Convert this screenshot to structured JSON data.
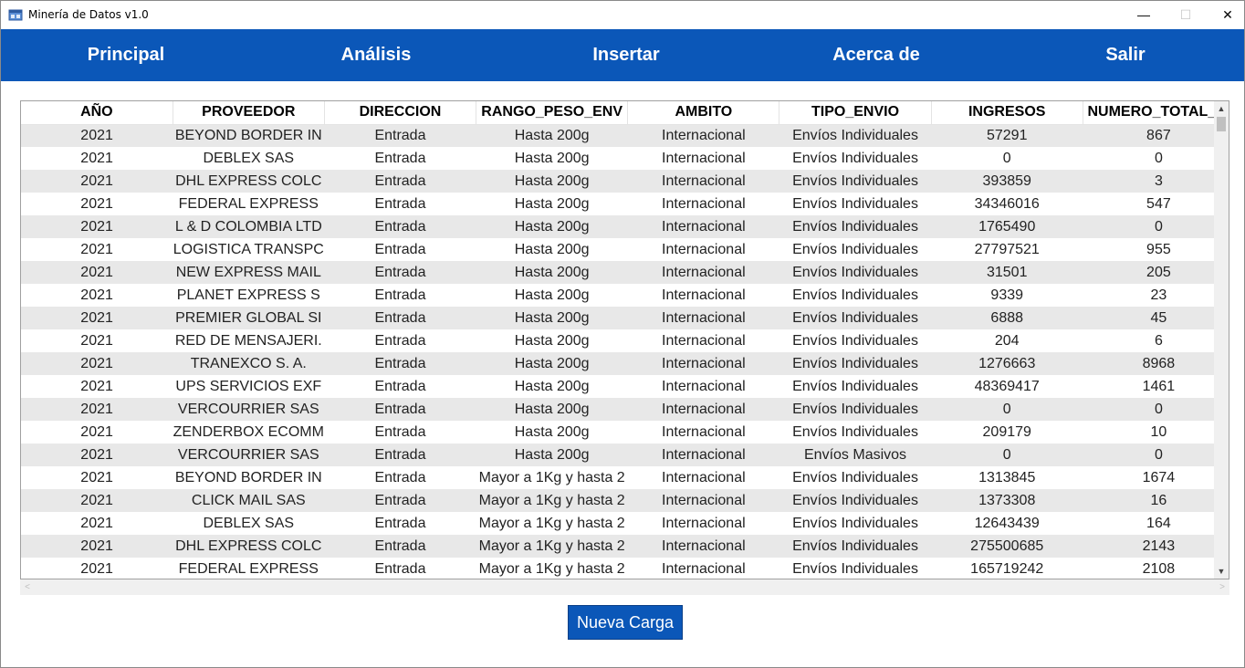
{
  "window": {
    "title": "Minería de Datos v1.0",
    "controls": {
      "minimize": "—",
      "maximize": "☐",
      "close": "✕"
    }
  },
  "nav": {
    "items": [
      {
        "label": "Principal"
      },
      {
        "label": "Análisis"
      },
      {
        "label": "Insertar"
      },
      {
        "label": "Acerca de"
      },
      {
        "label": "Salir"
      }
    ]
  },
  "table": {
    "columns": [
      "AÑO",
      "PROVEEDOR",
      "DIRECCION",
      "RANGO_PESO_ENV",
      "AMBITO",
      "TIPO_ENVIO",
      "INGRESOS",
      "NUMERO_TOTAL_EI"
    ],
    "rows": [
      [
        "2021",
        "BEYOND BORDER IN",
        "Entrada",
        "Hasta 200g",
        "Internacional",
        "Envíos Individuales",
        "57291",
        "867"
      ],
      [
        "2021",
        "DEBLEX SAS",
        "Entrada",
        "Hasta 200g",
        "Internacional",
        "Envíos Individuales",
        "0",
        "0"
      ],
      [
        "2021",
        "DHL EXPRESS COLC",
        "Entrada",
        "Hasta 200g",
        "Internacional",
        "Envíos Individuales",
        "393859",
        "3"
      ],
      [
        "2021",
        "FEDERAL EXPRESS",
        "Entrada",
        "Hasta 200g",
        "Internacional",
        "Envíos Individuales",
        "34346016",
        "547"
      ],
      [
        "2021",
        "L & D COLOMBIA LTD",
        "Entrada",
        "Hasta 200g",
        "Internacional",
        "Envíos Individuales",
        "1765490",
        "0"
      ],
      [
        "2021",
        "LOGISTICA TRANSPC",
        "Entrada",
        "Hasta 200g",
        "Internacional",
        "Envíos Individuales",
        "27797521",
        "955"
      ],
      [
        "2021",
        "NEW EXPRESS MAIL",
        "Entrada",
        "Hasta 200g",
        "Internacional",
        "Envíos Individuales",
        "31501",
        "205"
      ],
      [
        "2021",
        "PLANET EXPRESS S",
        "Entrada",
        "Hasta 200g",
        "Internacional",
        "Envíos Individuales",
        "9339",
        "23"
      ],
      [
        "2021",
        "PREMIER GLOBAL SI",
        "Entrada",
        "Hasta 200g",
        "Internacional",
        "Envíos Individuales",
        "6888",
        "45"
      ],
      [
        "2021",
        "RED DE MENSAJERI.",
        "Entrada",
        "Hasta 200g",
        "Internacional",
        "Envíos Individuales",
        "204",
        "6"
      ],
      [
        "2021",
        "TRANEXCO S. A.",
        "Entrada",
        "Hasta 200g",
        "Internacional",
        "Envíos Individuales",
        "1276663",
        "8968"
      ],
      [
        "2021",
        "UPS SERVICIOS EXF",
        "Entrada",
        "Hasta 200g",
        "Internacional",
        "Envíos Individuales",
        "48369417",
        "1461"
      ],
      [
        "2021",
        "VERCOURRIER SAS",
        "Entrada",
        "Hasta 200g",
        "Internacional",
        "Envíos Individuales",
        "0",
        "0"
      ],
      [
        "2021",
        "ZENDERBOX ECOMM",
        "Entrada",
        "Hasta 200g",
        "Internacional",
        "Envíos Individuales",
        "209179",
        "10"
      ],
      [
        "2021",
        "VERCOURRIER SAS",
        "Entrada",
        "Hasta 200g",
        "Internacional",
        "Envíos Masivos",
        "0",
        "0"
      ],
      [
        "2021",
        "BEYOND BORDER IN",
        "Entrada",
        "Mayor a 1Kg y hasta 2",
        "Internacional",
        "Envíos Individuales",
        "1313845",
        "1674"
      ],
      [
        "2021",
        "CLICK MAIL SAS",
        "Entrada",
        "Mayor a 1Kg y hasta 2",
        "Internacional",
        "Envíos Individuales",
        "1373308",
        "16"
      ],
      [
        "2021",
        "DEBLEX SAS",
        "Entrada",
        "Mayor a 1Kg y hasta 2",
        "Internacional",
        "Envíos Individuales",
        "12643439",
        "164"
      ],
      [
        "2021",
        "DHL EXPRESS COLC",
        "Entrada",
        "Mayor a 1Kg y hasta 2",
        "Internacional",
        "Envíos Individuales",
        "275500685",
        "2143"
      ],
      [
        "2021",
        "FEDERAL EXPRESS",
        "Entrada",
        "Mayor a 1Kg y hasta 2",
        "Internacional",
        "Envíos Individuales",
        "165719242",
        "2108"
      ]
    ]
  },
  "scrollbars": {
    "up_arrow": "▲",
    "down_arrow": "▼",
    "left_arrow": "<",
    "right_arrow": ">"
  },
  "actions": {
    "new_load_label": "Nueva Carga"
  },
  "colors": {
    "brand_blue": "#0b57b8",
    "row_alt": "#e8e8e8"
  },
  "icons": {
    "app": "app-window-icon"
  }
}
